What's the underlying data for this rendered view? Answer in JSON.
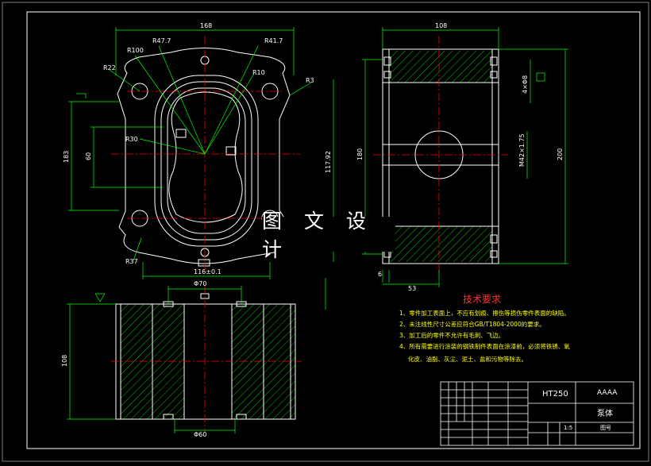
{
  "drawing": {
    "background": "#000000",
    "colors": {
      "outline": "#ffffff",
      "centerline": "#ff0000",
      "dimension": "#00ff00",
      "hatch": "#00ff00",
      "tech_text": "#ffff00",
      "heading": "#ff3333"
    },
    "top_view": {
      "dims": {
        "overall_width": "168",
        "r47": "R47.7",
        "r41": "R41.7",
        "r100": "R100",
        "r22": "R22",
        "r10": "R10",
        "r3": "R3",
        "r30": "R30",
        "r37": "R37",
        "height_183": "183",
        "height_60": "60",
        "height_117": "117.92",
        "base_116": "116±0.1"
      }
    },
    "side_view": {
      "dims": {
        "width_108": "108",
        "total_200": "200",
        "mid_180": "180",
        "thread": "M42×1.75",
        "hole_note": "4×Φ8",
        "offset_6": "6",
        "offset_53": "53"
      }
    },
    "bottom_view": {
      "dims": {
        "top_dia": "Φ70",
        "height_108": "108",
        "bottom_dia": "Φ60"
      }
    }
  },
  "tech_req": {
    "title": "技术要求",
    "items": [
      "1、零件加工表面上，不应有划痕、擦伤等损伤零件表面的缺陷。",
      "2、未注线性尺寸公差应符合GB/T1804-2000的要求。",
      "3、加工后的零件不允许有毛刺、飞边。",
      "4、所有需要进行涂装的钢铁制件表面在涂漆前，必须将铁锈、氧",
      "化皮、油脂、灰尘、泥土、盐和污物等除去。"
    ]
  },
  "title_block": {
    "material": "HT250",
    "code": "AAAA",
    "part_name": "泵体",
    "drawing_no_label": "图号",
    "scale": "1:5"
  },
  "watermark": "图 文 设 计"
}
